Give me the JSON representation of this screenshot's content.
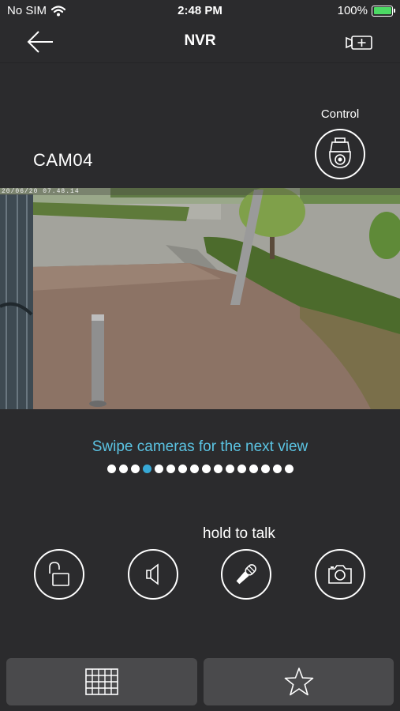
{
  "status_bar": {
    "carrier": "No SIM",
    "time": "2:48 PM",
    "battery": "100%"
  },
  "nav": {
    "title": "NVR",
    "back_icon": "arrow-left-icon",
    "add_camera_icon": "video-camera-plus-icon"
  },
  "control": {
    "label": "Control",
    "icon": "ptz-camera-icon"
  },
  "camera": {
    "name": "CAM04",
    "timestamp": "20/06/20  07.48.14"
  },
  "hint": "Swipe cameras for the next view",
  "pager": {
    "total": 16,
    "active_index": 3
  },
  "actions": {
    "talk_label": "hold to talk",
    "buttons": [
      {
        "name": "unlock-button",
        "icon": "unlock-icon"
      },
      {
        "name": "audio-button",
        "icon": "speaker-icon"
      },
      {
        "name": "talk-button",
        "icon": "microphone-icon"
      },
      {
        "name": "snapshot-button",
        "icon": "camera-icon"
      }
    ]
  },
  "tabs": [
    {
      "name": "tab-grid",
      "icon": "grid-icon"
    },
    {
      "name": "tab-favorites",
      "icon": "star-icon"
    }
  ],
  "colors": {
    "background": "#2b2b2d",
    "accent": "#37a9d6",
    "hint_text": "#5bc4e3",
    "tab_background": "#4a4a4c",
    "battery": "#4cd964"
  }
}
